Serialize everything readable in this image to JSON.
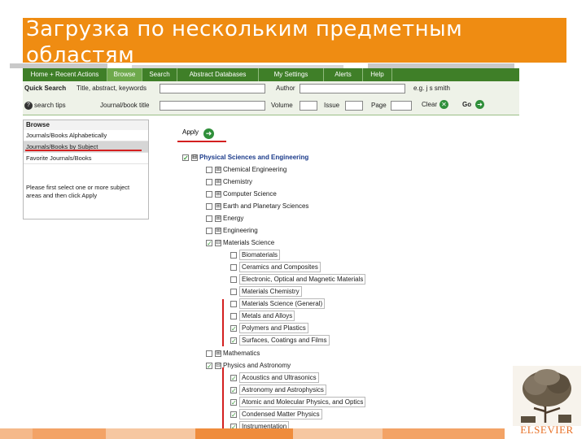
{
  "slide": {
    "title": "Загрузка по нескольким предметным областям"
  },
  "nav": {
    "tabs": [
      {
        "label": "Home + Recent Actions",
        "active": false
      },
      {
        "label": "Browse",
        "active": true
      },
      {
        "label": "Search",
        "active": false
      },
      {
        "label": "Abstract Databases",
        "active": false
      },
      {
        "label": "My Settings",
        "active": false
      },
      {
        "label": "Alerts",
        "active": false
      },
      {
        "label": "Help",
        "active": false
      }
    ]
  },
  "quick_search": {
    "label": "Quick Search",
    "title_label": "Title, abstract, keywords",
    "author_label": "Author",
    "author_hint": "e.g. j s smith",
    "search_tips": "search tips",
    "journal_label": "Journal/book title",
    "volume_label": "Volume",
    "issue_label": "Issue",
    "page_label": "Page",
    "clear_label": "Clear",
    "go_label": "Go"
  },
  "browse": {
    "heading": "Browse",
    "items": [
      {
        "label": "Journals/Books Alphabetically",
        "selected": false
      },
      {
        "label": "Journals/Books by Subject",
        "selected": true
      },
      {
        "label": "Favorite Journals/Books",
        "selected": false
      }
    ],
    "note": "Please first select one or more subject areas and then click Apply"
  },
  "apply": {
    "label": "Apply"
  },
  "tree": [
    {
      "label": "Physical Sciences and Engineering",
      "checked": true,
      "toggle": "⊟",
      "level": 0,
      "bold": true
    },
    {
      "label": "Chemical Engineering",
      "checked": false,
      "toggle": "⊞",
      "level": 1
    },
    {
      "label": "Chemistry",
      "checked": false,
      "toggle": "⊞",
      "level": 1
    },
    {
      "label": "Computer Science",
      "checked": false,
      "toggle": "⊞",
      "level": 1
    },
    {
      "label": "Earth and Planetary Sciences",
      "checked": false,
      "toggle": "⊞",
      "level": 1
    },
    {
      "label": "Energy",
      "checked": false,
      "toggle": "⊞",
      "level": 1
    },
    {
      "label": "Engineering",
      "checked": false,
      "toggle": "⊞",
      "level": 1
    },
    {
      "label": "Materials Science",
      "checked": true,
      "toggle": "⊟",
      "level": 1
    },
    {
      "label": "Biomaterials",
      "checked": false,
      "toggle": "",
      "level": 2
    },
    {
      "label": "Ceramics and Composites",
      "checked": false,
      "toggle": "",
      "level": 2
    },
    {
      "label": "Electronic, Optical and Magnetic Materials",
      "checked": false,
      "toggle": "",
      "level": 2
    },
    {
      "label": "Materials Chemistry",
      "checked": false,
      "toggle": "",
      "level": 2
    },
    {
      "label": "Materials Science (General)",
      "checked": false,
      "toggle": "",
      "level": 2
    },
    {
      "label": "Metals and Alloys",
      "checked": false,
      "toggle": "",
      "level": 2
    },
    {
      "label": "Polymers and Plastics",
      "checked": true,
      "toggle": "",
      "level": 2
    },
    {
      "label": "Surfaces, Coatings and Films",
      "checked": true,
      "toggle": "",
      "level": 2
    },
    {
      "label": "Mathematics",
      "checked": false,
      "toggle": "⊞",
      "level": 1
    },
    {
      "label": "Physics and Astronomy",
      "checked": true,
      "toggle": "⊟",
      "level": 1
    },
    {
      "label": "Acoustics and Ultrasonics",
      "checked": true,
      "toggle": "",
      "level": 2
    },
    {
      "label": "Astronomy and Astrophysics",
      "checked": true,
      "toggle": "",
      "level": 2
    },
    {
      "label": "Atomic and Molecular Physics, and Optics",
      "checked": true,
      "toggle": "",
      "level": 2
    },
    {
      "label": "Condensed Matter Physics",
      "checked": true,
      "toggle": "",
      "level": 2
    },
    {
      "label": "Instrumentation",
      "checked": true,
      "toggle": "",
      "level": 2
    }
  ],
  "logo": {
    "text": "ELSEVIER"
  },
  "colors": {
    "accent_orange": "#ef8c12",
    "nav_green": "#3f7f28",
    "active_tab": "#6ea94c",
    "highlight_red": "#d42020"
  }
}
